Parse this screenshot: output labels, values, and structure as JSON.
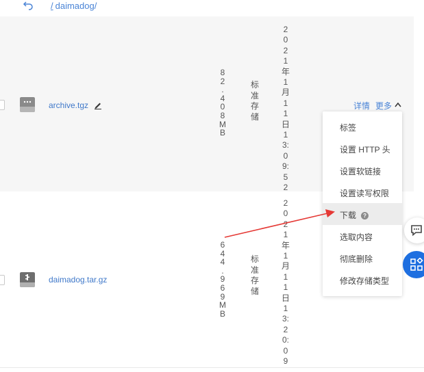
{
  "breadcrumb": {
    "slash": "/",
    "folder": "daimadog/"
  },
  "files": [
    {
      "name": "archive.tgz",
      "size_chars": [
        "8",
        "2",
        ".",
        "4",
        "0",
        "8",
        "M",
        "B"
      ],
      "storage_chars": [
        "标",
        "准",
        "存",
        "储"
      ],
      "date_chars": [
        "2",
        "0",
        "2",
        "1",
        "年",
        "1",
        "月",
        "1",
        "1",
        "日",
        "1",
        "3:",
        "0",
        "9:",
        "5",
        "2"
      ]
    },
    {
      "name": "daimadog.tar.gz",
      "size_chars": [
        "6",
        "4",
        "4",
        ".",
        "9",
        "6",
        "9",
        "M",
        "B"
      ],
      "storage_chars": [
        "标",
        "准",
        "存",
        "储"
      ],
      "date_chars": [
        "2",
        "0",
        "2",
        "1",
        "年",
        "1",
        "月",
        "1",
        "1",
        "日",
        "1",
        "3:",
        "2",
        "0:",
        "0",
        "9"
      ]
    }
  ],
  "actions": {
    "details": "详情",
    "more": "更多"
  },
  "menu": [
    "标签",
    "设置 HTTP 头",
    "设置软链接",
    "设置读写权限",
    "下载",
    "选取内容",
    "彻底删除",
    "修改存储类型"
  ],
  "help_glyph": "?",
  "colors": {
    "link": "#4a84d6",
    "accent": "#1e6fe0",
    "arrow": "#e53935"
  }
}
